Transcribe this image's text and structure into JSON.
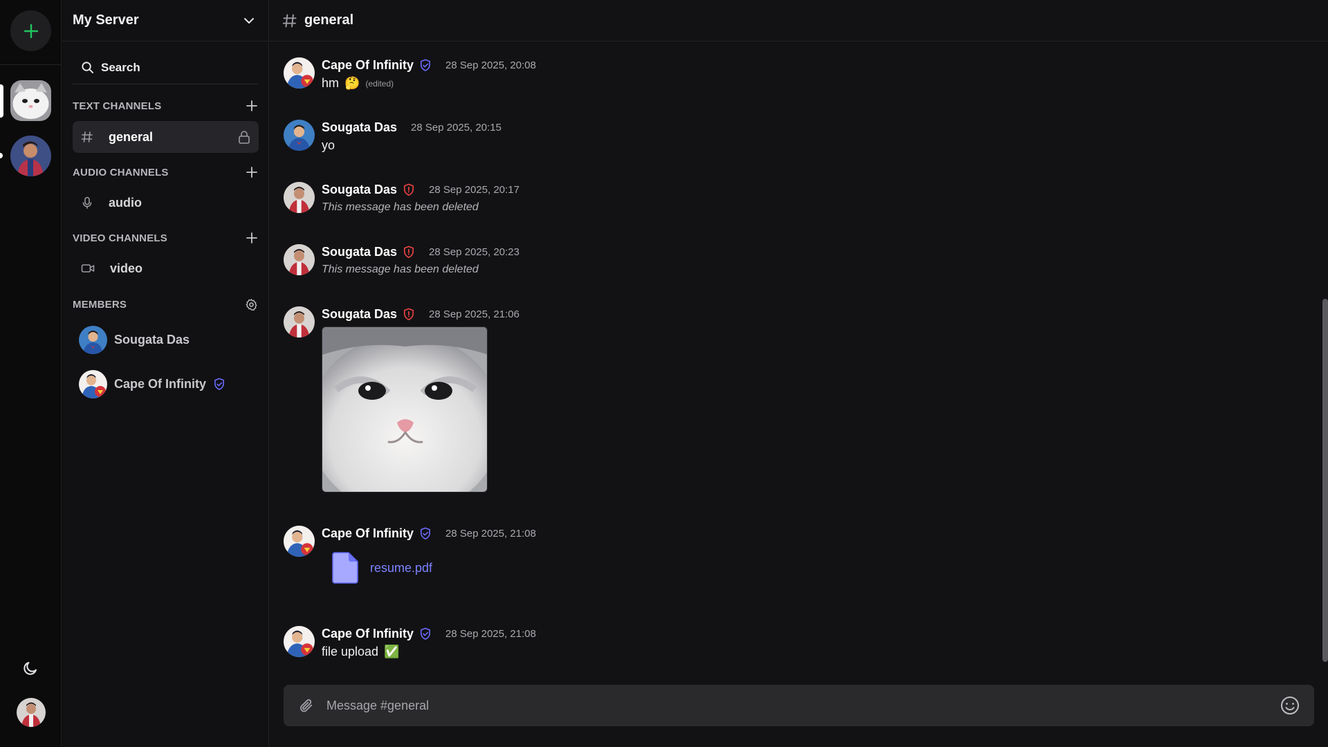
{
  "server": {
    "name": "My Server"
  },
  "search": {
    "label": "Search"
  },
  "sections": {
    "text": "TEXT CHANNELS",
    "audio": "AUDIO CHANNELS",
    "video": "VIDEO CHANNELS",
    "members": "MEMBERS"
  },
  "channels": {
    "text": [
      "general"
    ],
    "audio": [
      "audio"
    ],
    "video": [
      "video"
    ]
  },
  "members": [
    {
      "name": "Sougata Das",
      "badge": ""
    },
    {
      "name": "Cape Of Infinity",
      "badge": "shield-check-icon"
    }
  ],
  "header": {
    "channel": "general"
  },
  "messages": [
    {
      "author": "Cape Of Infinity",
      "badge": "shield-check-icon",
      "time": "28 Sep 2025, 20:08",
      "text": "hm",
      "emoji": "🤔",
      "edited": "(edited)"
    },
    {
      "author": "Sougata Das",
      "badge": "",
      "time": "28 Sep 2025, 20:15",
      "text": "yo"
    },
    {
      "author": "Sougata Das",
      "badge": "shield-alert-icon",
      "time": "28 Sep 2025, 20:17",
      "deleted": "This message has been deleted"
    },
    {
      "author": "Sougata Das",
      "badge": "shield-alert-icon",
      "time": "28 Sep 2025, 20:23",
      "deleted": "This message has been deleted"
    },
    {
      "author": "Sougata Das",
      "badge": "shield-alert-icon",
      "time": "28 Sep 2025, 21:06",
      "attachment": "image"
    },
    {
      "author": "Cape Of Infinity",
      "badge": "shield-check-icon",
      "time": "28 Sep 2025, 21:08",
      "file": "resume.pdf"
    },
    {
      "author": "Cape Of Infinity",
      "badge": "shield-check-icon",
      "time": "28 Sep 2025, 21:08",
      "text": "file upload",
      "emoji": "✅"
    }
  ],
  "composer": {
    "placeholder": "Message #general"
  },
  "colors": {
    "accent": "#22c55e",
    "link": "#7c83ff",
    "badge_blue": "#6b6bff",
    "badge_red": "#ef4444"
  }
}
